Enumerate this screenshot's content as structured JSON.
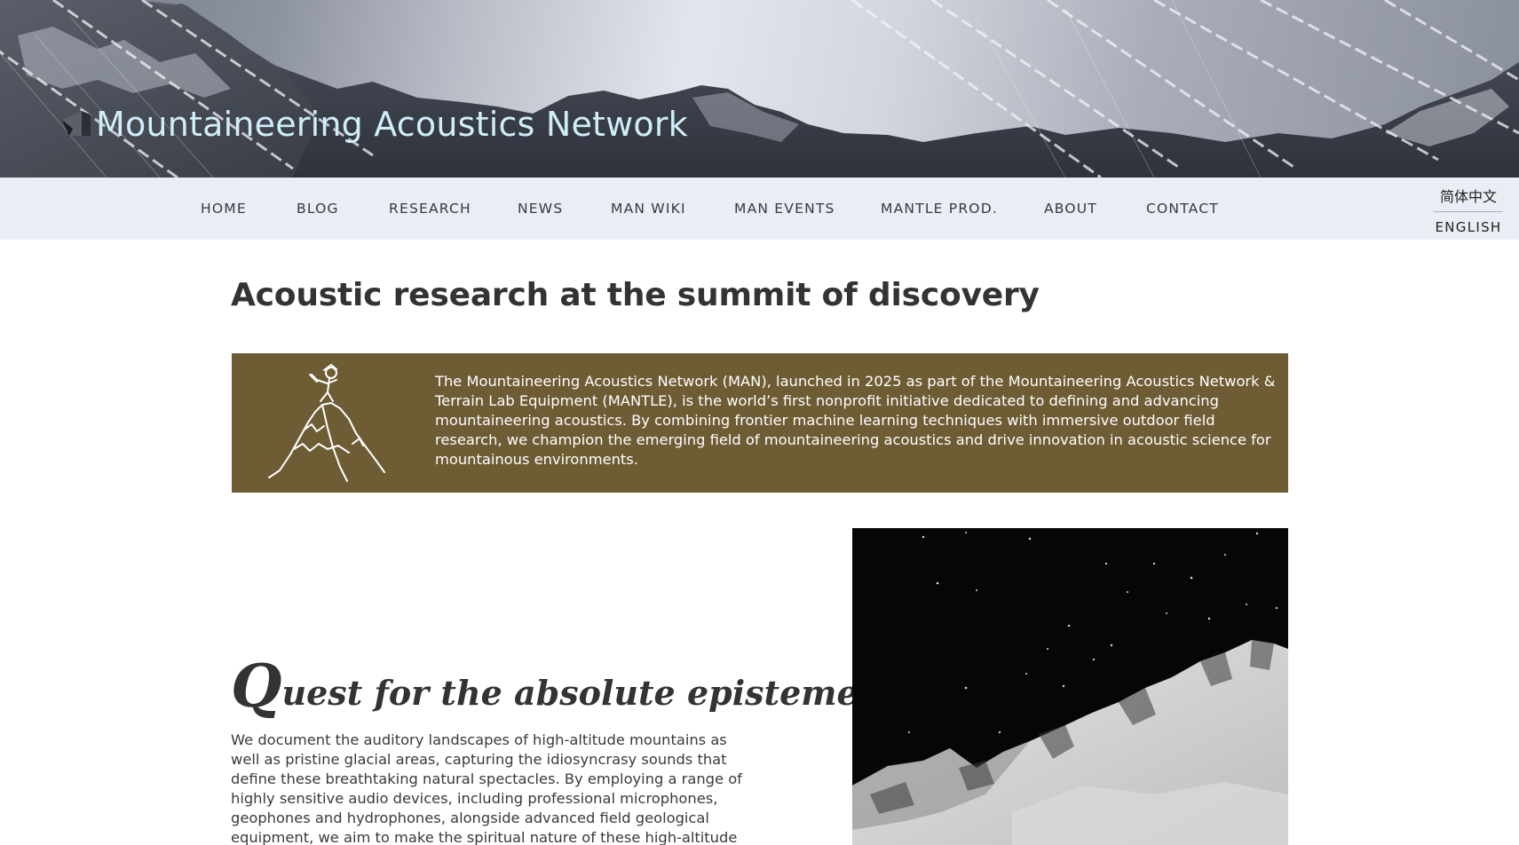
{
  "header": {
    "site_title": "Mountaineering Acoustics Network"
  },
  "nav": {
    "items": [
      {
        "label": "HOME"
      },
      {
        "label": "BLOG"
      },
      {
        "label": "RESEARCH"
      },
      {
        "label": "NEWS"
      },
      {
        "label": "MAN WIKI"
      },
      {
        "label": "MAN EVENTS"
      },
      {
        "label": "MANTLE PROD."
      },
      {
        "label": "ABOUT"
      },
      {
        "label": "CONTACT"
      }
    ],
    "languages": {
      "chinese": "简体中文",
      "english": "ENGLISH"
    }
  },
  "main": {
    "heading": "Acoustic research at the summit of discovery",
    "intro": {
      "text": "The Mountaineering Acoustics Network (MAN), launched in 2025 as part of the Mountaineering Acoustics Network & Terrain Lab Equipment (MANTLE), is the world’s first nonprofit initiative dedicated to defining and advancing mountaineering acoustics. By combining frontier machine learning techniques with immersive outdoor field research, we champion the emerging field of mountaineering acoustics and drive innovation in acoustic science for mountainous environments.",
      "background_color": "#6e5c35"
    },
    "section": {
      "title_dropcap": "Q",
      "title_rest": "uest for the absolute episteme",
      "body": "We document the auditory landscapes of high-altitude mountains as well as pristine glacial areas, capturing the idiosyncrasy sounds that define these breathtaking natural spectacles. By employing a range of highly sensitive audio devices, including professional microphones, geophones and hydrophones, alongside advanced field geological equipment, we aim to make the spiritual nature of these high-altitude"
    }
  },
  "colors": {
    "nav_background": "#e9eef4",
    "title_color": "#cfeef9",
    "text_dark": "#333333"
  }
}
